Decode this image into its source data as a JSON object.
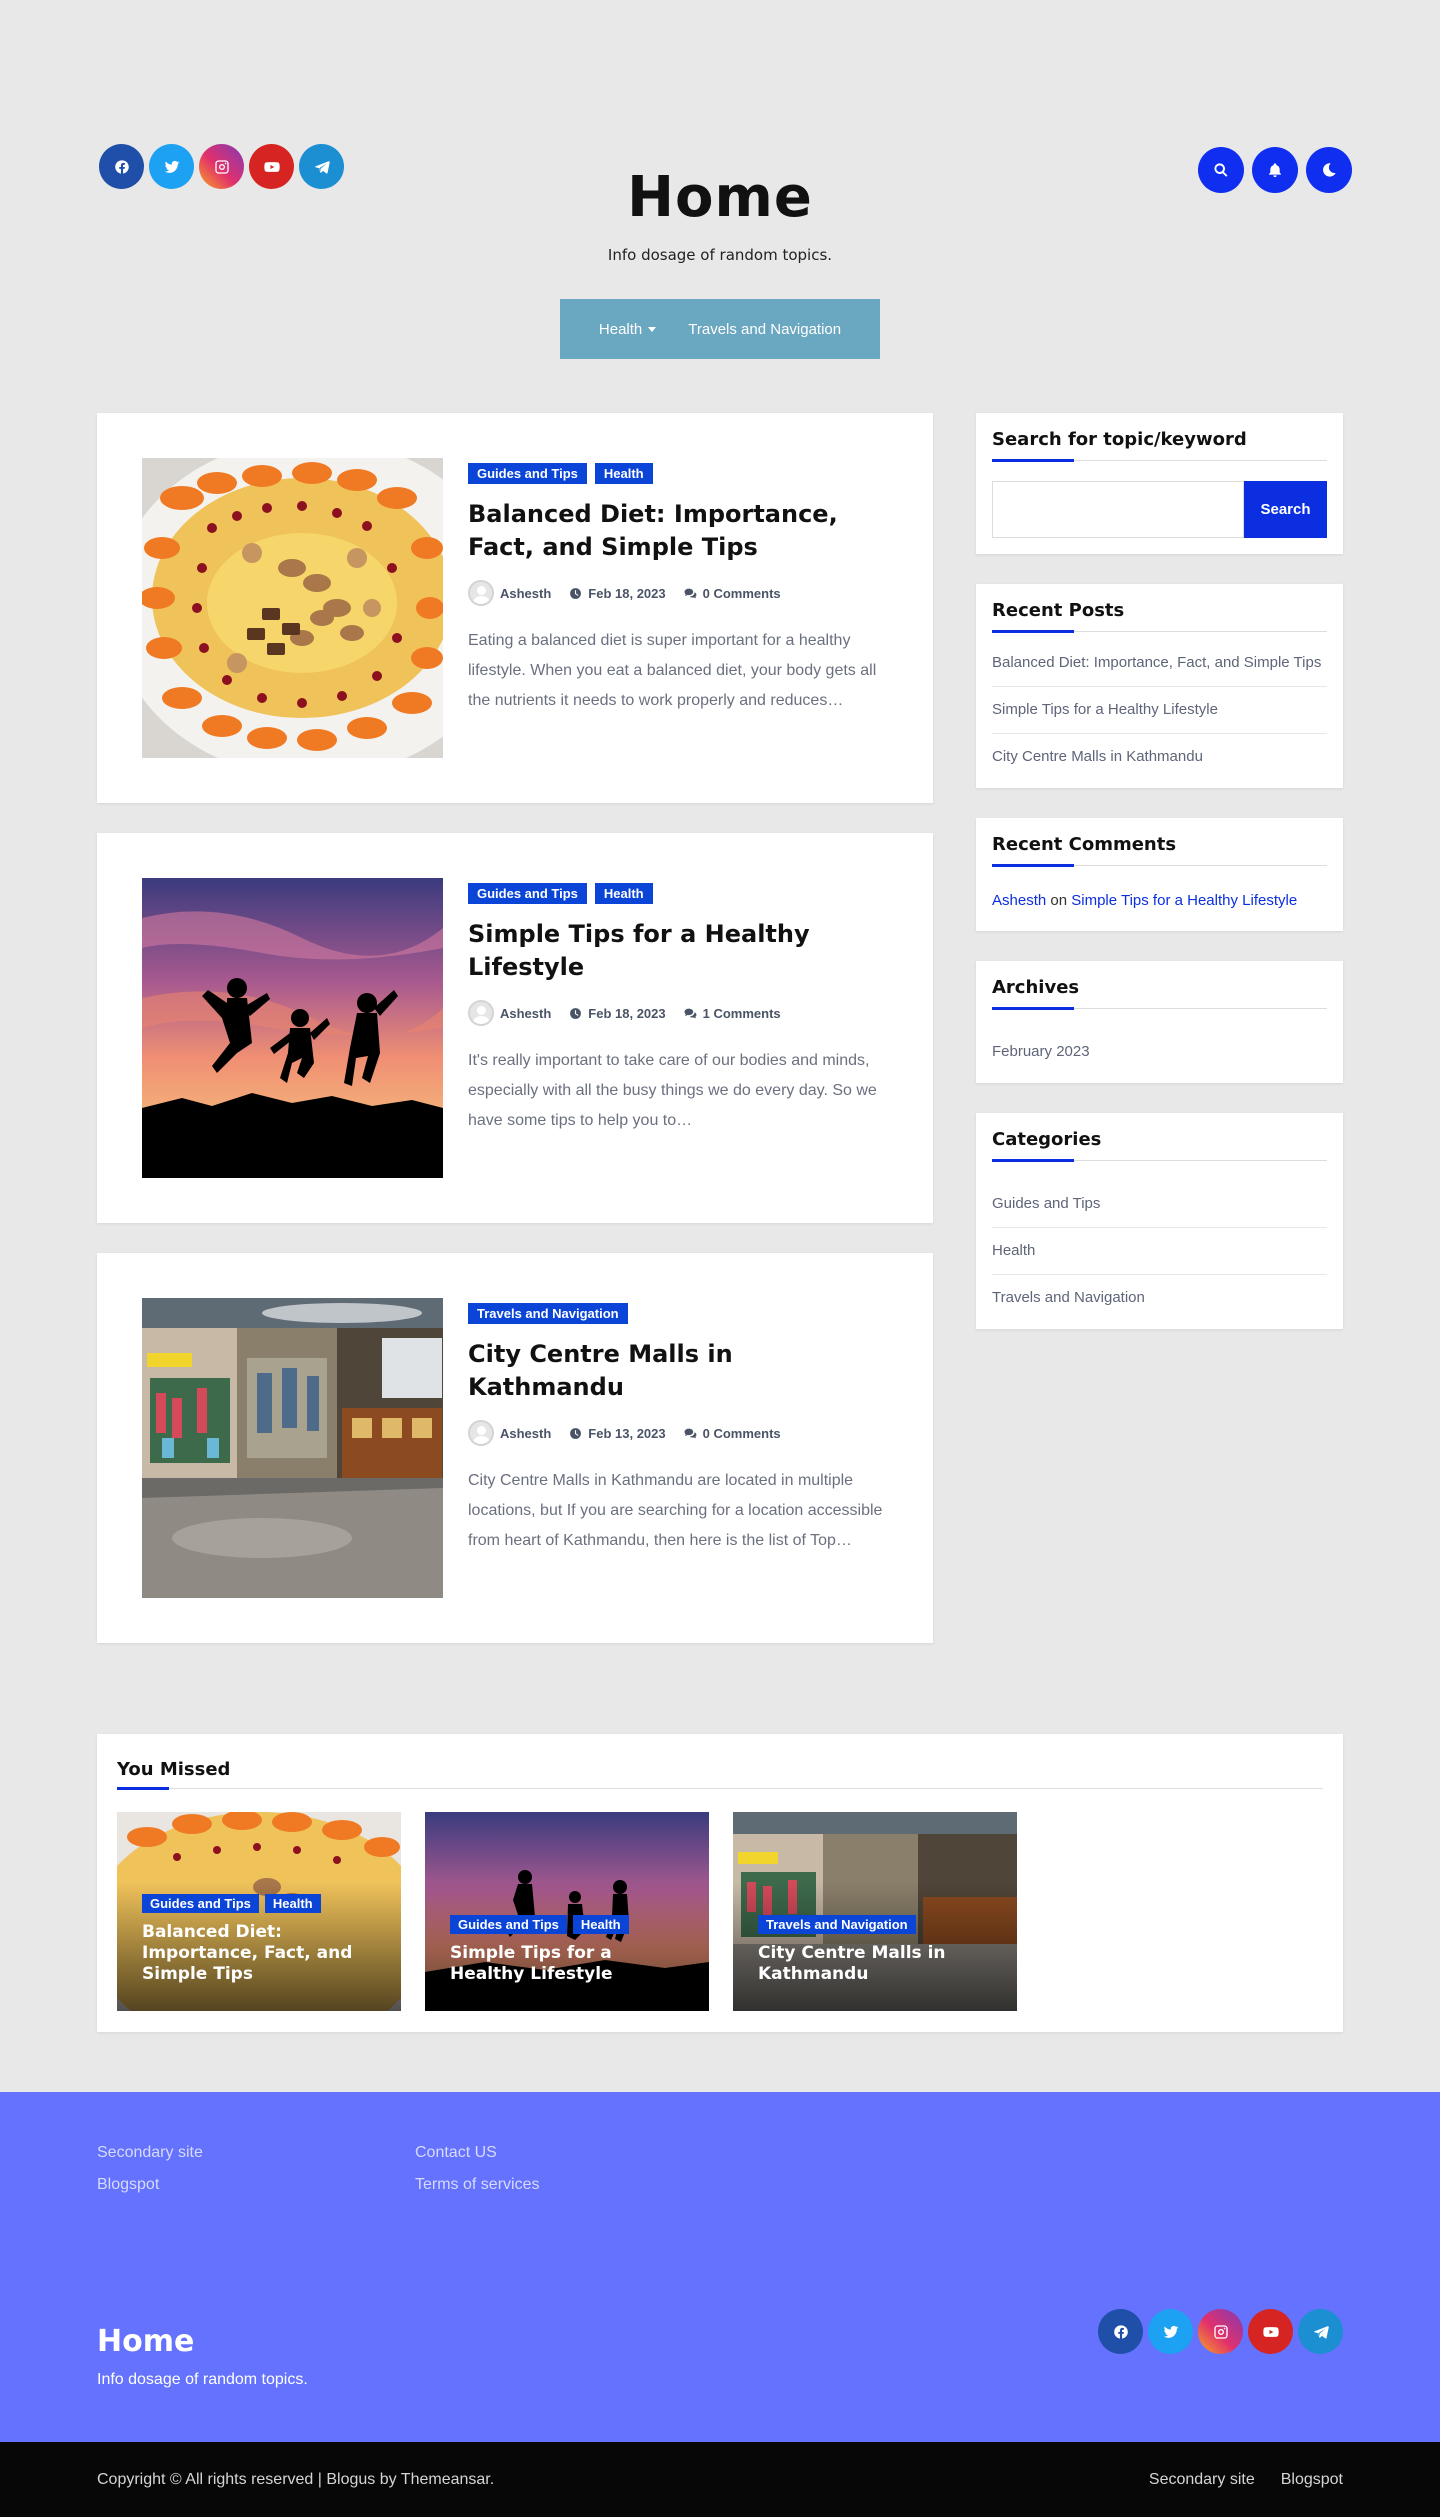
{
  "site": {
    "title": "Home",
    "tagline": "Info dosage of random topics."
  },
  "social_icons": [
    "facebook-icon",
    "twitter-icon",
    "instagram-icon",
    "youtube-icon",
    "telegram-icon"
  ],
  "header_tools": [
    "search-icon",
    "bell-icon",
    "moon-icon"
  ],
  "nav": {
    "items": [
      {
        "label": "Health",
        "has_dropdown": true
      },
      {
        "label": "Travels and Navigation",
        "has_dropdown": false
      }
    ]
  },
  "posts": [
    {
      "categories": [
        "Guides and Tips",
        "Health"
      ],
      "title": "Balanced Diet: Importance, Fact, and Simple Tips",
      "author": "Ashesth",
      "date": "Feb 18, 2023",
      "comments": "0 Comments",
      "excerpt": "Eating a balanced diet is super important for a healthy lifestyle. When you eat a balanced diet, your body gets all the nutrients it needs to work properly and reduces…"
    },
    {
      "categories": [
        "Guides and Tips",
        "Health"
      ],
      "title": "Simple Tips for a Healthy Lifestyle",
      "author": "Ashesth",
      "date": "Feb 18, 2023",
      "comments": "1 Comments",
      "excerpt": "It's really important to take care of our bodies and minds, especially with all the busy things we do every day. So we have some tips to help you to…"
    },
    {
      "categories": [
        "Travels and Navigation"
      ],
      "title": "City Centre Malls in Kathmandu",
      "author": "Ashesth",
      "date": "Feb 13, 2023",
      "comments": "0 Comments",
      "excerpt": "City Centre Malls in Kathmandu are located in multiple locations, but If you are searching for a location accessible from heart of Kathmandu, then here is the list of Top…"
    }
  ],
  "sidebar": {
    "search": {
      "title": "Search for topic/keyword",
      "button": "Search",
      "value": ""
    },
    "recent_posts": {
      "title": "Recent Posts",
      "items": [
        "Balanced Diet: Importance, Fact, and Simple Tips",
        "Simple Tips for a Healthy Lifestyle",
        "City Centre Malls in Kathmandu"
      ]
    },
    "recent_comments": {
      "title": "Recent Comments",
      "author": "Ashesth",
      "on": "on",
      "post": "Simple Tips for a Healthy Lifestyle"
    },
    "archives": {
      "title": "Archives",
      "items": [
        "February 2023"
      ]
    },
    "categories": {
      "title": "Categories",
      "items": [
        "Guides and Tips",
        "Health",
        "Travels and Navigation"
      ]
    }
  },
  "you_missed": {
    "title": "You Missed",
    "cards": [
      {
        "categories": [
          "Guides and Tips",
          "Health"
        ],
        "title": "Balanced Diet: Importance, Fact, and Simple Tips"
      },
      {
        "categories": [
          "Guides and Tips",
          "Health"
        ],
        "title": "Simple Tips for a Healthy Lifestyle"
      },
      {
        "categories": [
          "Travels and Navigation"
        ],
        "title": "City Centre Malls in Kathmandu"
      }
    ]
  },
  "footer": {
    "col1": [
      "Secondary site",
      "Blogspot"
    ],
    "col2": [
      "Contact US",
      "Terms of services"
    ],
    "title": "Home",
    "tagline": "Info dosage of random topics.",
    "copyright": "Copyright © All rights reserved | Blogus by Themeansar.",
    "bottom_links": [
      "Secondary site",
      "Blogspot"
    ]
  },
  "colors": {
    "accent": "#0b2fe0",
    "category_badge": "#0b45d8",
    "nav_bg": "#6aa7c0",
    "footer_bg": "#6472fd",
    "bottom_bar": "#070707",
    "page_bg": "#e8e8e8"
  }
}
